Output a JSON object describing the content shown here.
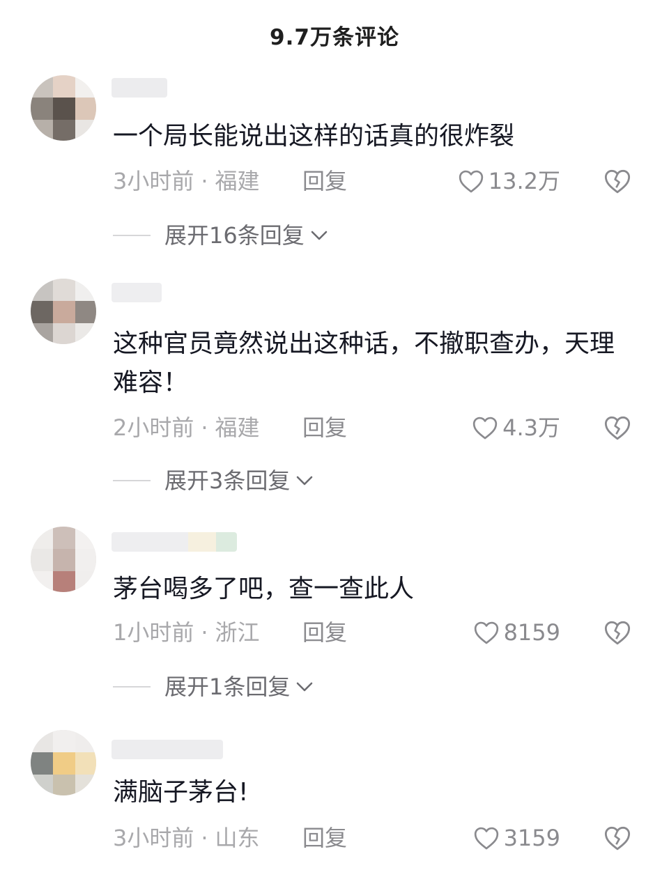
{
  "header": {
    "title": "9.7万条评论"
  },
  "comments": [
    {
      "text": "一个局长能说出这样的话真的很炸裂",
      "time": "3小时前",
      "location": "福建",
      "reply_label": "回复",
      "likes": "13.2万",
      "expand_label": "展开16条回复"
    },
    {
      "text": "这种官员竟然说出这种话，不撤职查办，天理难容！",
      "time": "2小时前",
      "location": "福建",
      "reply_label": "回复",
      "likes": "4.3万",
      "expand_label": "展开3条回复"
    },
    {
      "text": "茅台喝多了吧，查一查此人",
      "time": "1小时前",
      "location": "浙江",
      "reply_label": "回复",
      "likes": "8159",
      "expand_label": "展开1条回复"
    },
    {
      "text": "满脑子茅台!",
      "time": "3小时前",
      "location": "山东",
      "reply_label": "回复",
      "likes": "3159"
    }
  ],
  "icons": {
    "like": "heart-outline-icon",
    "dislike": "broken-heart-icon",
    "expand": "chevron-down-icon"
  },
  "colors": {
    "text": "#161823",
    "meta": "#a8a8ab",
    "secondary": "#8a8a8e"
  }
}
